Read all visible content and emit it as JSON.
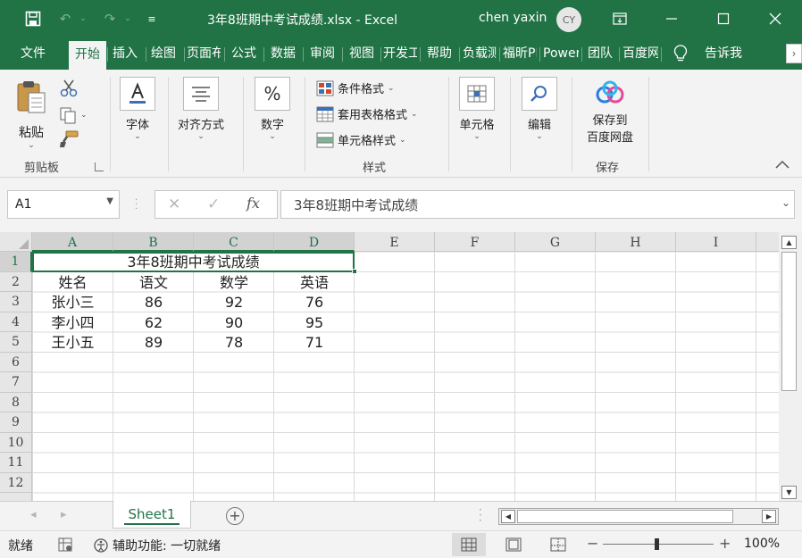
{
  "titlebar": {
    "title": "3年8班期中考试成绩.xlsx  -  Excel",
    "user_name": "chen yaxin",
    "avatar_initials": "CY"
  },
  "menu_tabs": [
    "文件",
    "开始",
    "插入",
    "绘图",
    "页面布局",
    "公式",
    "数据",
    "审阅",
    "视图",
    "开发工具",
    "帮助",
    "负载测试",
    "福昕PDF",
    "Power Pivot",
    "团队",
    "百度网盘"
  ],
  "tell_me": "告诉我",
  "ribbon": {
    "clipboard": {
      "paste": "粘贴",
      "label": "剪贴板"
    },
    "font": "字体",
    "alignment": "对齐方式",
    "number": "数字",
    "styles": {
      "conditional": "条件格式",
      "table": "套用表格格式",
      "cell_styles": "单元格样式",
      "label": "样式"
    },
    "cells": "单元格",
    "editing": "编辑",
    "save": {
      "line1": "保存到",
      "line2": "百度网盘",
      "label": "保存"
    }
  },
  "formula_bar": {
    "name_box": "A1",
    "content": "3年8班期中考试成绩"
  },
  "grid": {
    "columns": [
      "A",
      "B",
      "C",
      "D",
      "E",
      "F",
      "G",
      "H",
      "I"
    ],
    "rows": [
      "1",
      "2",
      "3",
      "4",
      "5",
      "6",
      "7",
      "8",
      "9",
      "10",
      "11",
      "12"
    ],
    "title": "3年8班期中考试成绩",
    "headers": [
      "姓名",
      "语文",
      "数学",
      "英语"
    ],
    "data": [
      [
        "张小三",
        "86",
        "92",
        "76"
      ],
      [
        "李小四",
        "62",
        "90",
        "95"
      ],
      [
        "王小五",
        "89",
        "78",
        "71"
      ]
    ]
  },
  "sheet_tabs": [
    "Sheet1"
  ],
  "statusbar": {
    "ready": "就绪",
    "accessibility": "辅助功能: 一切就绪",
    "zoom": "100%"
  },
  "colors": {
    "accent": "#217346",
    "ribbon_bg": "#f3f3f3"
  }
}
